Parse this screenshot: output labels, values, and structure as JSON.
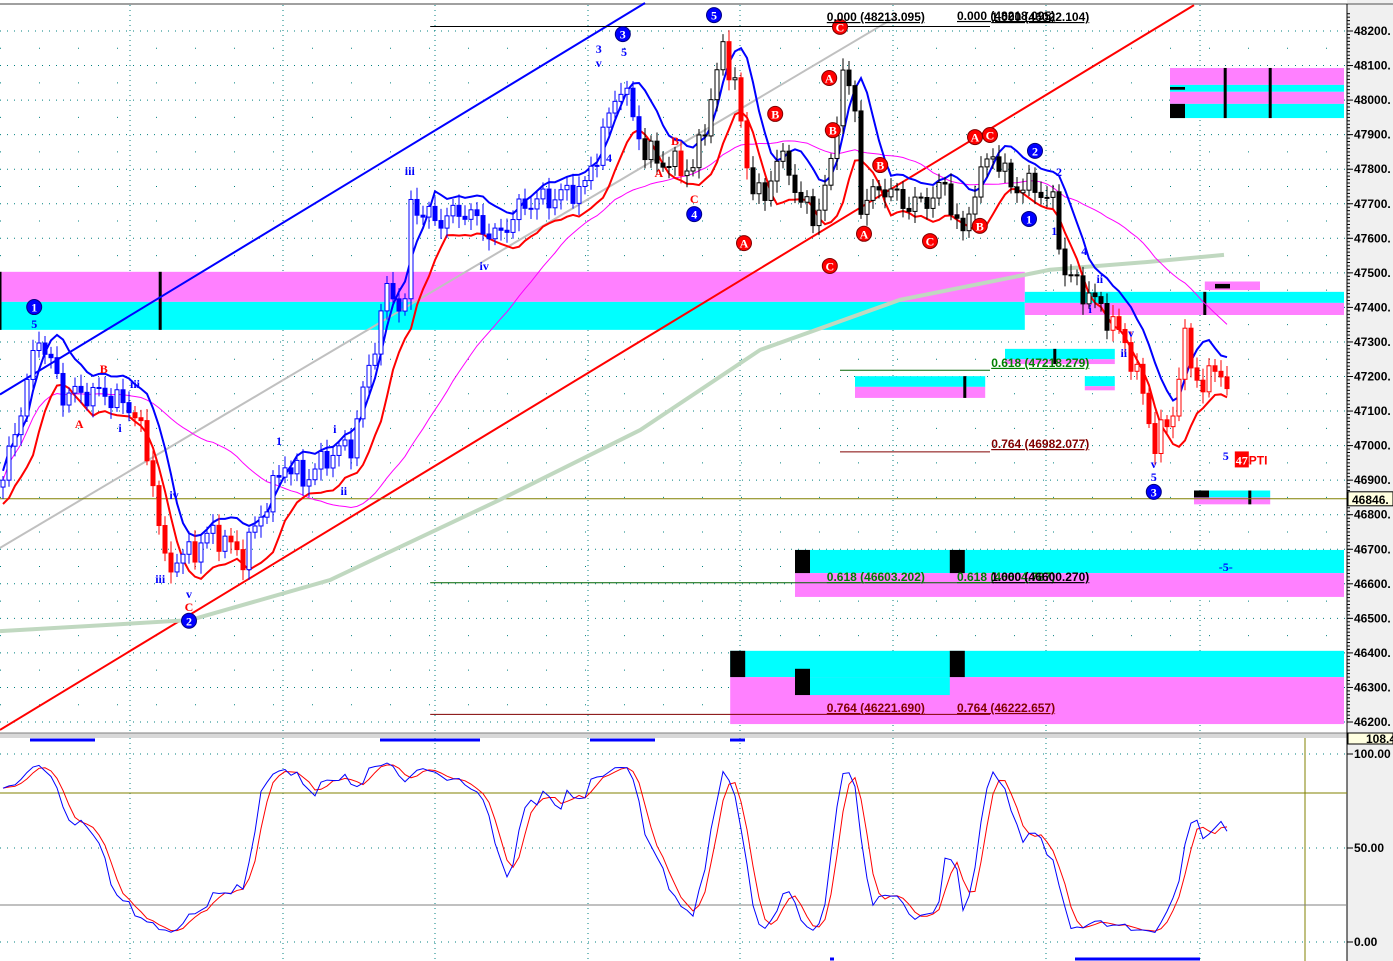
{
  "chart_data": {
    "type": "candlestick",
    "title": "",
    "price_axis": {
      "ticks": [
        "48200.",
        "48100.",
        "48000.",
        "47900.",
        "47800.",
        "47700.",
        "47600.",
        "47500.",
        "47400.",
        "47300.",
        "47200.",
        "47100.",
        "47000.",
        "46900.",
        "46800.",
        "46700.",
        "46600.",
        "46500.",
        "46400.",
        "46300.",
        "46200."
      ],
      "ylim": [
        46180,
        48260
      ]
    },
    "current_price": {
      "value": 46846,
      "label": "46846."
    },
    "indicator_axis": {
      "ticks": [
        "100.00",
        "50.00",
        "0.00"
      ],
      "top_label": "108.4",
      "ylim": [
        0,
        100
      ],
      "levels": [
        80,
        20
      ]
    },
    "price_path": [
      [
        0,
        46900
      ],
      [
        5,
        47250
      ],
      [
        6,
        47320
      ],
      [
        10,
        47150
      ],
      [
        17,
        47150
      ],
      [
        22,
        47100
      ],
      [
        25,
        46900
      ],
      [
        27,
        46650
      ],
      [
        32,
        46700
      ],
      [
        35,
        46750
      ],
      [
        40,
        46680
      ],
      [
        43,
        46800
      ],
      [
        47,
        46950
      ],
      [
        50,
        46900
      ],
      [
        55,
        46980
      ],
      [
        58,
        47000
      ],
      [
        62,
        47300
      ],
      [
        64,
        47450
      ],
      [
        67,
        47400
      ],
      [
        68,
        47700
      ],
      [
        72,
        47650
      ],
      [
        77,
        47680
      ],
      [
        82,
        47600
      ],
      [
        87,
        47700
      ],
      [
        92,
        47720
      ],
      [
        97,
        47750
      ],
      [
        100,
        47900
      ],
      [
        103,
        48050
      ],
      [
        107,
        47850
      ],
      [
        110,
        47820
      ],
      [
        115,
        47800
      ],
      [
        118,
        48000
      ],
      [
        120,
        48150
      ],
      [
        122,
        48050
      ],
      [
        124,
        47800
      ],
      [
        127,
        47700
      ],
      [
        129,
        47850
      ],
      [
        132,
        47750
      ],
      [
        135,
        47650
      ],
      [
        138,
        47800
      ],
      [
        140,
        48100
      ],
      [
        142,
        47950
      ],
      [
        143,
        47700
      ],
      [
        147,
        47750
      ],
      [
        150,
        47700
      ],
      [
        153,
        47700
      ],
      [
        157,
        47750
      ],
      [
        160,
        47600
      ],
      [
        162,
        47750
      ],
      [
        165,
        47850
      ],
      [
        168,
        47750
      ],
      [
        172,
        47750
      ],
      [
        175,
        47700
      ],
      [
        177,
        47500
      ],
      [
        180,
        47450
      ],
      [
        183,
        47400
      ],
      [
        187,
        47300
      ],
      [
        190,
        47150
      ],
      [
        192,
        47000
      ],
      [
        195,
        47100
      ],
      [
        197,
        47300
      ],
      [
        200,
        47150
      ],
      [
        202,
        47250
      ],
      [
        204,
        47150
      ]
    ],
    "long_ma": [
      [
        0,
        46463
      ],
      [
        31.7,
        46495
      ],
      [
        55,
        46611
      ],
      [
        83.3,
        46843
      ],
      [
        106.7,
        47045
      ],
      [
        126.7,
        47277
      ],
      [
        150,
        47422
      ],
      [
        175,
        47509
      ],
      [
        191.7,
        47532
      ],
      [
        204,
        47552
      ]
    ],
    "trend_lines": [
      {
        "name": "blue-channel-line",
        "color": "#0000ff",
        "p1": [
          0,
          47148
        ],
        "p2": [
          107.5,
          48281
        ]
      },
      {
        "name": "red-trend-line",
        "color": "#ff0000",
        "p1": [
          0,
          46177
        ],
        "p2": [
          199,
          48275
        ]
      },
      {
        "name": "gray-trend-line",
        "color": "#c0c0c0",
        "p1": [
          0,
          46704
        ],
        "p2": [
          149,
          48238
        ]
      }
    ],
    "fib_lines": [
      {
        "price": 48213,
        "from": 71.7,
        "to": 165,
        "color": "#000000"
      },
      {
        "price": 46603,
        "from": 71.7,
        "to": 165,
        "color": "#006400"
      },
      {
        "price": 46222,
        "from": 71.7,
        "to": 165,
        "color": "#800000"
      },
      {
        "price": 47218,
        "from": 140,
        "to": 165,
        "color": "#006400"
      },
      {
        "price": 46982,
        "from": 140,
        "to": 165,
        "color": "#800000"
      }
    ],
    "fib_labels": [
      {
        "text": "0.000 (48213.095)",
        "bar": 137.8,
        "price": 48229,
        "color": "#000000"
      },
      {
        "text": "0.000 (48218.095)",
        "bar": 159.5,
        "price": 48232,
        "color": "#000000"
      },
      {
        "text": "1.000 (46022.104)",
        "bar": 165.2,
        "price": 48229,
        "color": "#000000"
      },
      {
        "text": "0.618 (47218.279)",
        "bar": 165.2,
        "price": 47228,
        "color": "#008000"
      },
      {
        "text": "0.764 (46982.077)",
        "bar": 165.2,
        "price": 46993,
        "color": "#800000"
      },
      {
        "text": "0.618 (46603.202)",
        "bar": 137.8,
        "price": 46608,
        "color": "#008000"
      },
      {
        "text": "0.618 (46604.787)",
        "bar": 159.5,
        "price": 46608,
        "color": "#008000"
      },
      {
        "text": "1.000 (46600.270)",
        "bar": 165.2,
        "price": 46608,
        "color": "#000000"
      },
      {
        "text": "0.764 (46221.690)",
        "bar": 137.8,
        "price": 46229,
        "color": "#800000"
      },
      {
        "text": "0.764 (46222.657)",
        "bar": 159.5,
        "price": 46229,
        "color": "#800000"
      }
    ],
    "zones": [
      {
        "from": 0,
        "to": 170.8,
        "bands": [
          [
            47503,
            47416,
            "#ff80ff"
          ],
          [
            47416,
            47335,
            "#00ffff"
          ]
        ]
      },
      {
        "from": 170.8,
        "to": 224,
        "bands": [
          [
            47445,
            47413,
            "#00ffff"
          ],
          [
            47413,
            47378,
            "#ff80ff"
          ]
        ]
      },
      {
        "from": 195,
        "to": 224,
        "bands": [
          [
            48093,
            48044,
            "#ff80ff"
          ],
          [
            48044,
            48024,
            "#00ffff"
          ],
          [
            48024,
            47989,
            "#ff80ff"
          ],
          [
            47989,
            47948,
            "#00ffff"
          ]
        ]
      },
      {
        "from": 142.5,
        "to": 164.2,
        "bands": [
          [
            47201,
            47170,
            "#00ffff"
          ],
          [
            47170,
            47138,
            "#ff80ff"
          ]
        ]
      },
      {
        "from": 167.5,
        "to": 185.8,
        "bands": [
          [
            47280,
            47250,
            "#00ffff"
          ],
          [
            47250,
            47236,
            "#ff80ff"
          ]
        ]
      },
      {
        "from": 180.8,
        "to": 185.8,
        "bands": [
          [
            47201,
            47172,
            "#00ffff"
          ],
          [
            47172,
            47160,
            "#ff80ff"
          ]
        ]
      },
      {
        "from": 132.5,
        "to": 224,
        "bands": [
          [
            46698,
            46631,
            "#00ffff"
          ],
          [
            46631,
            46562,
            "#ff80ff"
          ]
        ]
      },
      {
        "from": 121.7,
        "to": 224,
        "bands": [
          [
            46406,
            46330,
            "#00ffff"
          ],
          [
            46330,
            46194,
            "#ff80ff"
          ]
        ]
      },
      {
        "from": 135,
        "to": 158.3,
        "bands": [
          [
            46330,
            46278,
            "#00ffff"
          ]
        ]
      },
      {
        "from": 199,
        "to": 211.7,
        "bands": [
          [
            46870,
            46850,
            "#00ffff"
          ],
          [
            46850,
            46830,
            "#ff80ff"
          ]
        ]
      },
      {
        "from": 200.8,
        "to": 210,
        "bands": [
          [
            47475,
            47450,
            "#ff80ff"
          ]
        ]
      }
    ],
    "zone_blocks": [
      [
        121.7,
        124.2,
        46406,
        46330
      ],
      [
        132.5,
        135,
        46698,
        46631
      ],
      [
        132.5,
        135,
        46354,
        46278
      ],
      [
        158.3,
        160.8,
        46698,
        46631
      ],
      [
        158.3,
        160.8,
        46406,
        46330
      ],
      [
        195,
        197.5,
        47989,
        47948
      ],
      [
        195,
        197.5,
        48038,
        48030
      ],
      [
        199,
        201.5,
        46870,
        46850
      ],
      [
        202.5,
        205,
        47468,
        47455
      ]
    ],
    "zone_markers": [
      [
        0,
        47503,
        47335
      ],
      [
        26.7,
        47503,
        47335
      ],
      [
        160.8,
        47201,
        47138
      ],
      [
        204.2,
        48093,
        47948
      ],
      [
        211.7,
        48093,
        47948
      ],
      [
        208.3,
        46870,
        46830
      ],
      [
        200.8,
        47445,
        47378
      ],
      [
        175.8,
        47280,
        47236
      ]
    ],
    "wave_labels": [
      {
        "t": "1",
        "bar": 5.7,
        "price": 47401,
        "style": "blue-circle"
      },
      {
        "t": "2",
        "bar": 31.5,
        "price": 46493,
        "style": "blue-circle"
      },
      {
        "t": "3",
        "bar": 103.8,
        "price": 48191,
        "style": "blue-circle"
      },
      {
        "t": "5",
        "bar": 119,
        "price": 48246,
        "style": "blue-circle"
      },
      {
        "t": "4",
        "bar": 115.7,
        "price": 47670,
        "style": "blue-circle"
      },
      {
        "t": "1",
        "bar": 171.5,
        "price": 47656,
        "style": "blue-circle"
      },
      {
        "t": "2",
        "bar": 172.5,
        "price": 47853,
        "style": "blue-circle"
      },
      {
        "t": "3",
        "bar": 192.3,
        "price": 46866,
        "style": "blue-circle"
      },
      {
        "t": "C",
        "bar": 140,
        "price": 48212,
        "style": "red-circle"
      },
      {
        "t": "A",
        "bar": 138.2,
        "price": 48064,
        "style": "red-circle"
      },
      {
        "t": "B",
        "bar": 138.8,
        "price": 47913,
        "style": "red-circle"
      },
      {
        "t": "A",
        "bar": 124,
        "price": 47586,
        "style": "red-circle"
      },
      {
        "t": "C",
        "bar": 138.3,
        "price": 47520,
        "style": "red-circle"
      },
      {
        "t": "B",
        "bar": 129.2,
        "price": 47960,
        "style": "red-circle"
      },
      {
        "t": "B",
        "bar": 146.7,
        "price": 47812,
        "style": "red-circle"
      },
      {
        "t": "A",
        "bar": 144,
        "price": 47613,
        "style": "red-circle"
      },
      {
        "t": "C",
        "bar": 155,
        "price": 47592,
        "style": "red-circle"
      },
      {
        "t": "B",
        "bar": 163.3,
        "price": 47636,
        "style": "red-circle"
      },
      {
        "t": "A",
        "bar": 162.5,
        "price": 47893,
        "style": "red-circle"
      },
      {
        "t": "C",
        "bar": 165,
        "price": 47899,
        "style": "red-circle"
      },
      {
        "t": "5",
        "bar": 5.7,
        "price": 47355,
        "style": "blue"
      },
      {
        "t": "3",
        "bar": 99.8,
        "price": 48151,
        "style": "blue"
      },
      {
        "t": "v",
        "bar": 99.8,
        "price": 48110,
        "style": "blue"
      },
      {
        "t": "5",
        "bar": 104,
        "price": 48142,
        "style": "blue"
      },
      {
        "t": "4",
        "bar": 101.5,
        "price": 47835,
        "style": "blue"
      },
      {
        "t": "iii",
        "bar": 68.3,
        "price": 47798,
        "style": "blue"
      },
      {
        "t": "iv",
        "bar": 80.7,
        "price": 47523,
        "style": "blue"
      },
      {
        "t": "i",
        "bar": 20,
        "price": 47054,
        "style": "blue"
      },
      {
        "t": "iii",
        "bar": 22.5,
        "price": 47181,
        "style": "blue"
      },
      {
        "t": "iv",
        "bar": 29,
        "price": 46860,
        "style": "blue"
      },
      {
        "t": "iii",
        "bar": 26.7,
        "price": 46617,
        "style": "blue"
      },
      {
        "t": "v",
        "bar": 31.5,
        "price": 46574,
        "style": "blue"
      },
      {
        "t": "1",
        "bar": 46.5,
        "price": 47016,
        "style": "blue"
      },
      {
        "t": "i",
        "bar": 55.8,
        "price": 47051,
        "style": "blue"
      },
      {
        "t": "ii",
        "bar": 57.3,
        "price": 46872,
        "style": "blue"
      },
      {
        "t": "1",
        "bar": 175.7,
        "price": 47624,
        "style": "blue"
      },
      {
        "t": "2",
        "bar": 176.5,
        "price": 47795,
        "style": "blue"
      },
      {
        "t": "4",
        "bar": 180.7,
        "price": 47566,
        "style": "blue"
      },
      {
        "t": "i",
        "bar": 181.7,
        "price": 47398,
        "style": "blue"
      },
      {
        "t": "ii",
        "bar": 183.3,
        "price": 47485,
        "style": "blue"
      },
      {
        "t": "v",
        "bar": 188.5,
        "price": 47329,
        "style": "blue"
      },
      {
        "t": "ii",
        "bar": 187.3,
        "price": 47271,
        "style": "blue"
      },
      {
        "t": "v",
        "bar": 192.3,
        "price": 46950,
        "style": "blue"
      },
      {
        "t": "5",
        "bar": 192.3,
        "price": 46912,
        "style": "blue"
      },
      {
        "t": "5",
        "bar": 204.3,
        "price": 46973,
        "style": "blue"
      },
      {
        "t": "-5-",
        "bar": 204.3,
        "price": 46652,
        "style": "blue"
      },
      {
        "t": "A",
        "bar": 13.2,
        "price": 47066,
        "style": "red"
      },
      {
        "t": "B",
        "bar": 17.3,
        "price": 47225,
        "style": "red"
      },
      {
        "t": "C",
        "bar": 31.5,
        "price": 46536,
        "style": "red"
      },
      {
        "t": "A",
        "bar": 109.8,
        "price": 47792,
        "style": "red"
      },
      {
        "t": "B",
        "bar": 112.5,
        "price": 47885,
        "style": "red"
      },
      {
        "t": "C",
        "bar": 115.7,
        "price": 47717,
        "style": "red"
      }
    ],
    "pti_label": {
      "text": "PTI",
      "badge": "47",
      "bar": 205.8,
      "price": 46960
    }
  },
  "colors": {
    "fast_ma": "#0000ff",
    "slow_ma": "#ff0000",
    "mid_ma": "#ff00ff",
    "long_ma": "#c0d8c0",
    "grid": "#008080",
    "stoch_k": "#0000ff",
    "stoch_d": "#ff0000"
  }
}
